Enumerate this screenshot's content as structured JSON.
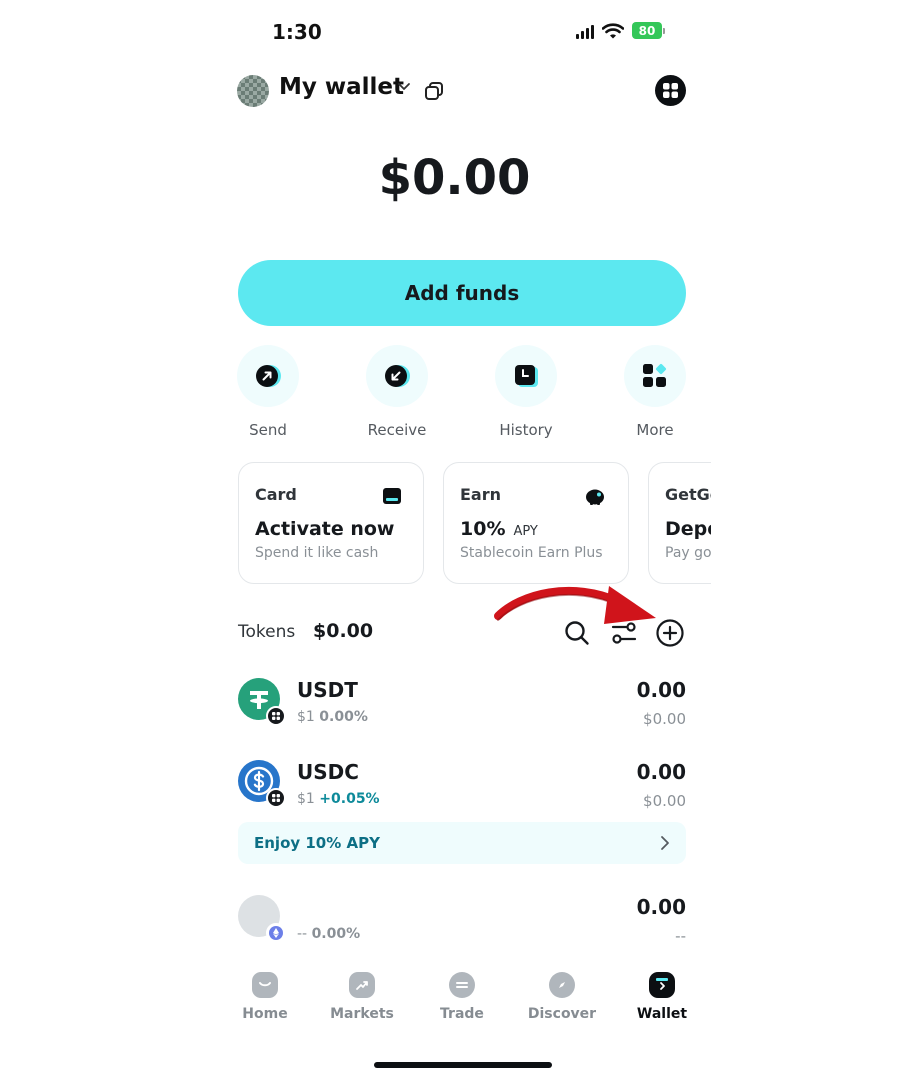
{
  "status_bar": {
    "time": "1:30",
    "battery": "80"
  },
  "header": {
    "wallet_name": "My wallet"
  },
  "balance": "$0.00",
  "add_funds_label": "Add funds",
  "actions": [
    {
      "label": "Send",
      "icon": "arrow-up-right-icon"
    },
    {
      "label": "Receive",
      "icon": "arrow-down-left-icon"
    },
    {
      "label": "History",
      "icon": "history-icon"
    },
    {
      "label": "More",
      "icon": "apps-icon"
    }
  ],
  "cards": [
    {
      "title": "Card",
      "main": "Activate now",
      "main_suffix": "",
      "sub": "Spend it like cash",
      "icon": "card-icon"
    },
    {
      "title": "Earn",
      "main": "10%",
      "main_suffix": "APY",
      "sub": "Stablecoin Earn Plus",
      "icon": "piggy-bank-icon"
    },
    {
      "title": "GetGo",
      "main": "Deposit",
      "main_suffix": "",
      "sub": "Pay go",
      "icon": ""
    }
  ],
  "tokens": {
    "label": "Tokens",
    "total": "$0.00",
    "items": [
      {
        "symbol": "USDT",
        "price": "$1",
        "change": "0.00%",
        "amount": "0.00",
        "value": "$0.00",
        "color": "#26a17b"
      },
      {
        "symbol": "USDC",
        "price": "$1",
        "change": "+0.05%",
        "amount": "0.00",
        "value": "$0.00",
        "color": "#2775ca"
      },
      {
        "symbol": "",
        "price": "--",
        "change": "0.00%",
        "amount": "0.00",
        "value": "--",
        "color": "#dde1e4"
      }
    ]
  },
  "promo": {
    "text": "Enjoy 10% APY"
  },
  "tabs": [
    {
      "label": "Home",
      "icon": "home-icon"
    },
    {
      "label": "Markets",
      "icon": "markets-icon"
    },
    {
      "label": "Trade",
      "icon": "trade-icon"
    },
    {
      "label": "Discover",
      "icon": "compass-icon"
    },
    {
      "label": "Wallet",
      "icon": "wallet-icon",
      "active": true
    }
  ],
  "colors": {
    "accent": "#5ce8f0",
    "accent_soft": "#effcfd",
    "annotation_arrow": "#d0141b"
  }
}
